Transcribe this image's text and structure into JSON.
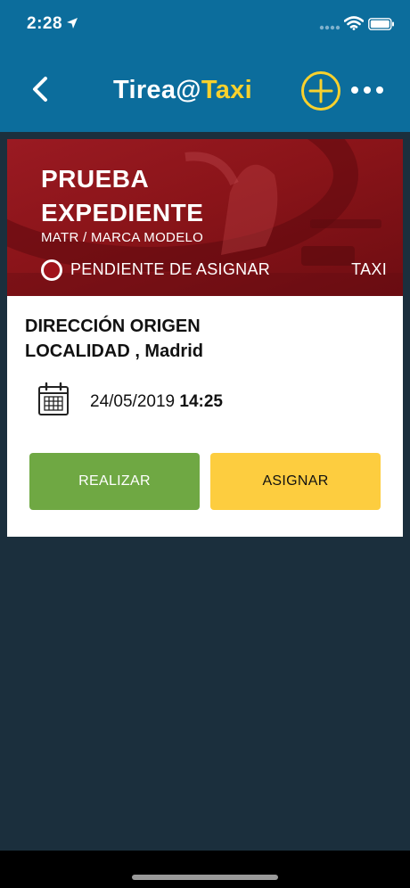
{
  "status_bar": {
    "time": "2:28",
    "location_icon": "location-arrow-icon",
    "signal_icon": "signal-dots-icon",
    "wifi_icon": "wifi-icon",
    "battery_icon": "battery-icon"
  },
  "nav": {
    "back_icon": "chevron-left-icon",
    "logo_part1": "Tirea@",
    "logo_part2": "Taxi",
    "add_icon": "plus-circle-icon",
    "more_icon": "ellipsis-icon",
    "colors": {
      "bar": "#0c6d9c",
      "accent": "#f8d12d"
    }
  },
  "card": {
    "title_line1": "PRUEBA",
    "title_line2": "EXPEDIENTE",
    "subtitle": "MATR / MARCA MODELO",
    "status": "PENDIENTE DE ASIGNAR",
    "status_color": "#a0141c",
    "service_type": "TAXI",
    "origin_line1": "DIRECCIÓN ORIGEN",
    "origin_line2": "LOCALIDAD , Madrid",
    "calendar_icon": "calendar-icon",
    "date": "24/05/2019",
    "time": "14:25",
    "buttons": {
      "realizar": "REALIZAR",
      "asignar": "ASIGNAR"
    }
  },
  "colors": {
    "background": "#1b2f3d",
    "realizar": "#6fa843",
    "asignar": "#fdcd3f"
  }
}
